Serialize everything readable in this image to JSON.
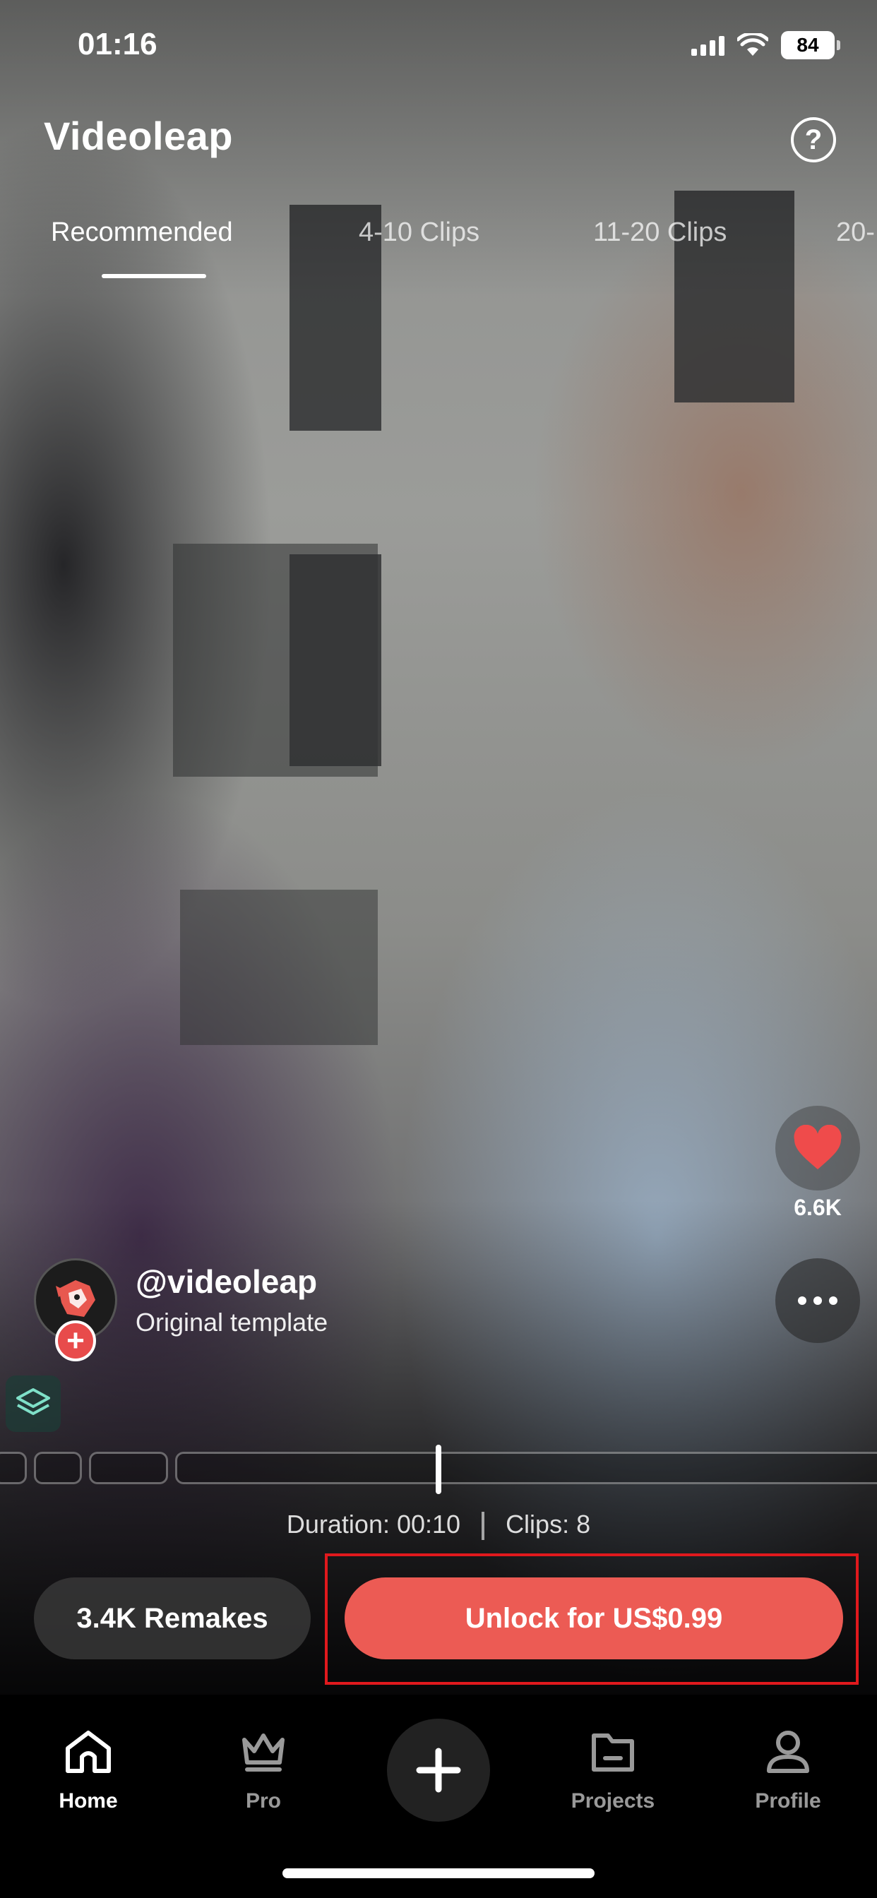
{
  "status_bar": {
    "time": "01:16",
    "battery": "84"
  },
  "header": {
    "title": "Videoleap",
    "help_label": "?"
  },
  "tabs": [
    {
      "label": "Recommended",
      "active": true
    },
    {
      "label": "4-10 Clips",
      "active": false
    },
    {
      "label": "11-20 Clips",
      "active": false
    },
    {
      "label": "20-",
      "active": false
    }
  ],
  "template": {
    "creator_handle": "@videoleap",
    "subtitle": "Original template",
    "likes": "6.6K",
    "duration_text": "Duration: 00:10",
    "clips_text": "Clips: 8"
  },
  "actions": {
    "remakes_label": "3.4K Remakes",
    "unlock_label": "Unlock for US$0.99",
    "follow_label": "+"
  },
  "bottom_nav": [
    {
      "label": "Home",
      "icon": "home-icon",
      "active": true
    },
    {
      "label": "Pro",
      "icon": "crown-icon",
      "active": false
    },
    {
      "label": "",
      "icon": "plus-icon",
      "active": false
    },
    {
      "label": "Projects",
      "icon": "folder-icon",
      "active": false
    },
    {
      "label": "Profile",
      "icon": "user-icon",
      "active": false
    }
  ],
  "colors": {
    "accent": "#ec5b54",
    "highlight_border": "#e0191d",
    "like_heart": "#ef4b4b",
    "background": "#000000"
  }
}
